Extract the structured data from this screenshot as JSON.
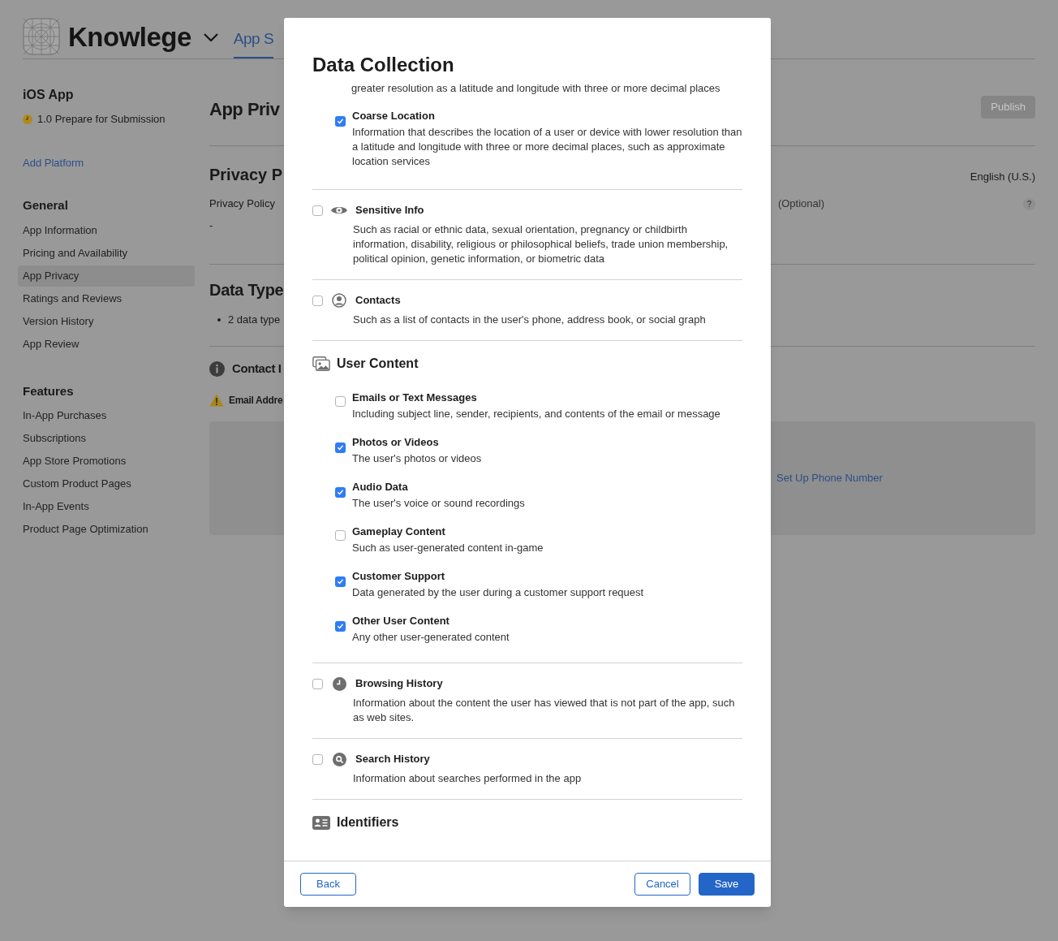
{
  "header": {
    "app_name": "Knowlege",
    "tabs": [
      {
        "label": "App S",
        "selected": true
      }
    ]
  },
  "sidebar": {
    "platform": "iOS App",
    "status": "1.0 Prepare for Submission",
    "add_platform": "Add Platform",
    "sections": [
      {
        "title": "General",
        "items": [
          {
            "label": "App Information",
            "selected": false
          },
          {
            "label": "Pricing and Availability",
            "selected": false
          },
          {
            "label": "App Privacy",
            "selected": true
          },
          {
            "label": "Ratings and Reviews",
            "selected": false
          },
          {
            "label": "Version History",
            "selected": false
          },
          {
            "label": "App Review",
            "selected": false
          }
        ]
      },
      {
        "title": "Features",
        "items": [
          {
            "label": "In-App Purchases",
            "selected": false
          },
          {
            "label": "Subscriptions",
            "selected": false
          },
          {
            "label": "App Store Promotions",
            "selected": false
          },
          {
            "label": "Custom Product Pages",
            "selected": false
          },
          {
            "label": "In-App Events",
            "selected": false
          },
          {
            "label": "Product Page Optimization",
            "selected": false
          }
        ]
      }
    ]
  },
  "main": {
    "title": "App Priv",
    "publish": {
      "label": "Publish",
      "disabled": true
    },
    "privacy_policy": {
      "heading": "Privacy P",
      "language": "English (U.S.)",
      "field_label": "Privacy Policy",
      "optional": "(Optional)",
      "help": "?",
      "value": "-"
    },
    "data_types": {
      "heading": "Data Type",
      "bullets": [
        "2 data type"
      ]
    },
    "contact": {
      "heading": "Contact I",
      "warning": "Email Addre",
      "link": "Set Up Phone Number"
    }
  },
  "modal": {
    "title": "Data Collection",
    "sections": [
      {
        "kind": "continuation",
        "fragment": "greater resolution as a latitude and longitude with three or more decimal places",
        "options": [
          {
            "label": "Coarse Location",
            "checked": true,
            "description": "Information that describes the location of a user or device with lower resolution than a latitude and longitude with three or more decimal places, such as approximate location services"
          }
        ]
      },
      {
        "kind": "category",
        "label": "Sensitive Info",
        "checked": false,
        "description": "Such as racial or ethnic data, sexual orientation, pregnancy or childbirth information, disability, religious or philosophical beliefs, trade union membership, political opinion, genetic information, or biometric data"
      },
      {
        "kind": "category",
        "label": "Contacts",
        "checked": false,
        "description": "Such as a list of contacts in the user's phone, address book, or social graph"
      },
      {
        "kind": "group",
        "heading": "User Content",
        "options": [
          {
            "label": "Emails or Text Messages",
            "checked": false,
            "description": "Including subject line, sender, recipients, and contents of the email or message"
          },
          {
            "label": "Photos or Videos",
            "checked": true,
            "description": "The user's photos or videos"
          },
          {
            "label": "Audio Data",
            "checked": true,
            "description": "The user's voice or sound recordings"
          },
          {
            "label": "Gameplay Content",
            "checked": false,
            "description": "Such as user-generated content in-game"
          },
          {
            "label": "Customer Support",
            "checked": true,
            "description": "Data generated by the user during a customer support request"
          },
          {
            "label": "Other User Content",
            "checked": true,
            "description": "Any other user-generated content"
          }
        ]
      },
      {
        "kind": "category",
        "label": "Browsing History",
        "checked": false,
        "description": "Information about the content the user has viewed that is not part of the app, such as web sites."
      },
      {
        "kind": "category",
        "label": "Search History",
        "checked": false,
        "description": "Information about searches performed in the app"
      },
      {
        "kind": "group",
        "heading": "Identifiers"
      }
    ],
    "footer": {
      "left": [
        {
          "label": "Back",
          "kind": "outline"
        }
      ],
      "right": [
        {
          "label": "Cancel",
          "kind": "outline"
        },
        {
          "label": "Save",
          "kind": "primary"
        }
      ]
    }
  }
}
